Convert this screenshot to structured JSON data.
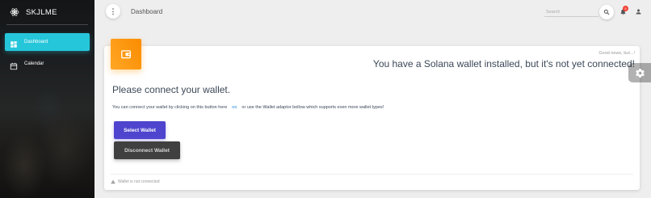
{
  "app": {
    "brand": "SKJLME",
    "brand_icon": "react-atom-icon"
  },
  "sidebar": {
    "items": [
      {
        "label": "Dashboard",
        "icon": "dashboard-icon",
        "active": true
      },
      {
        "label": "Calendar",
        "icon": "calendar-icon",
        "active": false
      }
    ]
  },
  "topbar": {
    "title": "Dashboard",
    "search_placeholder": "Search",
    "notifications_count": "5"
  },
  "card": {
    "category": "Good news, but...!",
    "headline": "You have a Solana wallet installed, but it's not yet connected!",
    "section_title": "Please connect your wallet.",
    "desc_before": "You can connect your wallet by clicking on this button here",
    "desc_link": "oo",
    "desc_after": "or use the Wallet adaptor bellow which supports even more wallet types!",
    "select_label": "Select Wallet",
    "disconnect_label": "Disconnect Wallet",
    "footer": "Wallet is not connected"
  },
  "colors": {
    "accent": "#26c6da",
    "card_icon": "#ff9800",
    "select_button": "#4e44ce",
    "disconnect_button": "#404040",
    "badge": "#f44336"
  }
}
